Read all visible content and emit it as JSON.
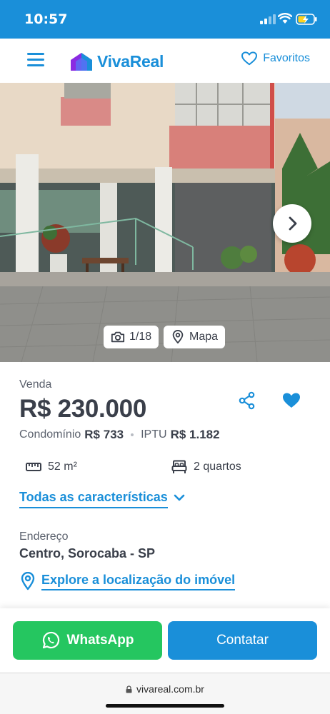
{
  "status_bar": {
    "time": "10:57"
  },
  "header": {
    "logo_text": "VivaReal",
    "favorites_label": "Favoritos",
    "brand_color": "#1a8fd9"
  },
  "gallery": {
    "photo_counter": "1/18",
    "map_label": "Mapa"
  },
  "listing": {
    "sale_type": "Venda",
    "price": "R$ 230.000",
    "condo_label": "Condomínio",
    "condo_value": "R$ 733",
    "iptu_label": "IPTU",
    "iptu_value": "R$ 1.182",
    "area": "52 m²",
    "bedrooms": "2 quartos",
    "all_features_label": "Todas as características",
    "address_label": "Endereço",
    "address": "Centro, Sorocaba - SP",
    "explore_label": "Explore a localização do imóvel"
  },
  "actions": {
    "whatsapp_label": "WhatsApp",
    "contact_label": "Contatar",
    "whatsapp_color": "#25c660"
  },
  "browser": {
    "url": "vivareal.com.br"
  }
}
